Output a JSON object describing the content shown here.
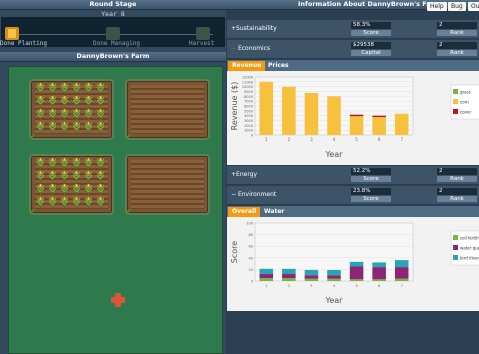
{
  "left": {
    "round_stage_title": "Round Stage",
    "year_label": "Year 8",
    "steps": [
      "Done Planting",
      "Done Managing",
      "Harvest"
    ],
    "farm_title": "DannyBrown's Farm"
  },
  "right": {
    "info_title": "Information About DannyBrown's Farm",
    "header_buttons": [
      "Help",
      "Bug",
      "Ou"
    ],
    "sustainability": {
      "label": "Sustainability",
      "toggle": "+",
      "score": "58.3%",
      "score_label": "Score",
      "rank": "2",
      "rank_label": "Rank"
    },
    "economics": {
      "label": "Economics",
      "toggle": "−",
      "capital": "$29538",
      "capital_label": "Capital",
      "rank": "2",
      "rank_label": "Rank"
    },
    "econ_tabs": [
      "Revenue",
      "Prices"
    ],
    "energy": {
      "label": "Energy",
      "toggle": "+",
      "score": "52.2%",
      "score_label": "Score",
      "rank": "2",
      "rank_label": "Rank"
    },
    "environment": {
      "label": "Environment",
      "toggle": "−",
      "score": "23.8%",
      "score_label": "Score",
      "rank": "2",
      "rank_label": "Rank"
    },
    "env_tabs": [
      "Overall",
      "Water"
    ]
  },
  "chart_data": [
    {
      "type": "bar",
      "ylabel": "Revenue ($)",
      "xlabel": "Year",
      "ylim": [
        0,
        12000
      ],
      "yticks": [
        0,
        1000,
        2000,
        3000,
        4000,
        5000,
        6000,
        7000,
        8000,
        9000,
        10000,
        11000,
        12000
      ],
      "categories": [
        "1",
        "2",
        "3",
        "4",
        "5",
        "6",
        "7"
      ],
      "series": [
        {
          "name": "grass",
          "color": "#7cb342",
          "values": [
            0,
            0,
            0,
            0,
            0,
            0,
            0
          ]
        },
        {
          "name": "corn",
          "color": "#f6c23e",
          "values": [
            11000,
            10000,
            8700,
            8000,
            3900,
            3700,
            4400
          ]
        },
        {
          "name": "cover",
          "color": "#b71c1c",
          "values": [
            0,
            0,
            0,
            0,
            300,
            300,
            0
          ]
        }
      ],
      "legend": "right",
      "legend_labels": [
        "grass",
        "corn",
        "cover"
      ]
    },
    {
      "type": "bar",
      "ylabel": "Score",
      "xlabel": "Year",
      "ylim": [
        0,
        100
      ],
      "yticks": [
        0,
        20,
        40,
        60,
        80,
        100
      ],
      "categories": [
        "1",
        "2",
        "3",
        "4",
        "5",
        "6",
        "7"
      ],
      "series": [
        {
          "name": "soil fertility",
          "color": "#7cb342",
          "values": [
            5,
            5,
            4,
            4,
            3,
            3,
            4
          ]
        },
        {
          "name": "water quality",
          "color": "#8e2476",
          "values": [
            7,
            7,
            6,
            6,
            22,
            21,
            20
          ]
        },
        {
          "name": "bird diversity",
          "color": "#26a6b5",
          "values": [
            9,
            9,
            9,
            9,
            8,
            8,
            12
          ]
        }
      ],
      "legend": "right",
      "legend_labels": [
        "soil fertility",
        "water quality",
        "bird diversity"
      ]
    }
  ]
}
